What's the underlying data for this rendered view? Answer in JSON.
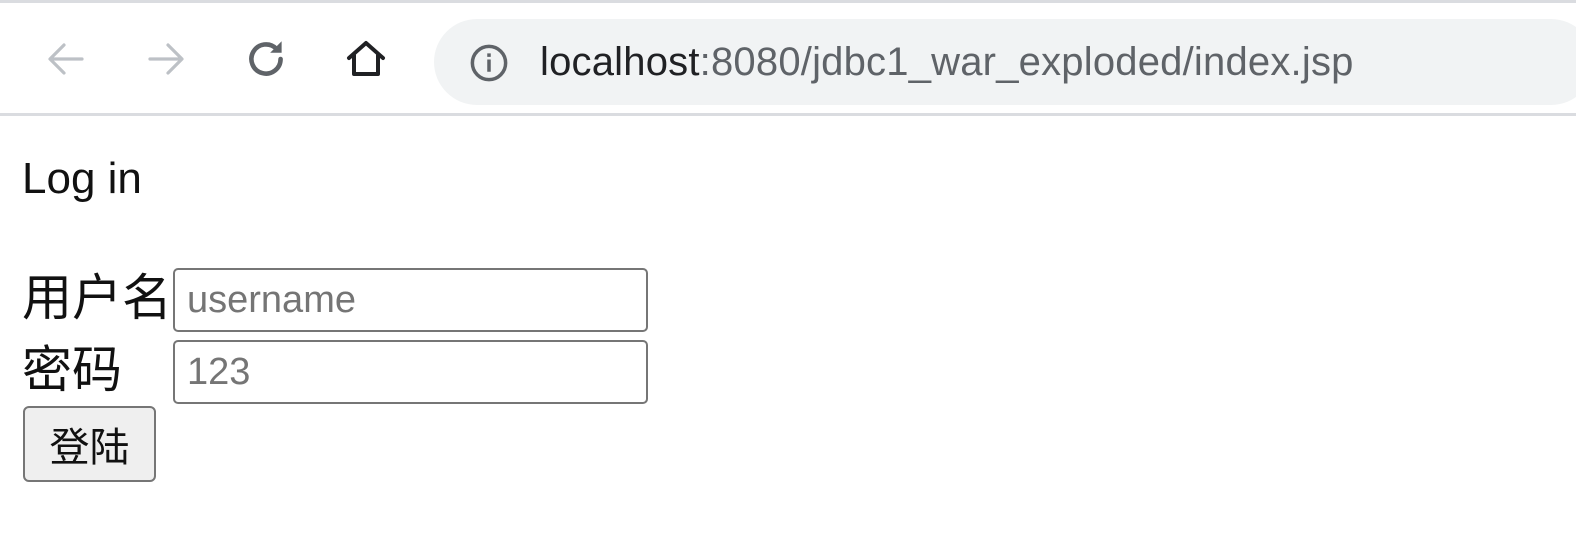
{
  "browser": {
    "url_host": "localhost",
    "url_rest": ":8080/jdbc1_war_exploded/index.jsp",
    "icons": [
      "back-arrow-icon",
      "forward-arrow-icon",
      "reload-icon",
      "home-icon",
      "site-info-icon"
    ]
  },
  "page": {
    "title": "Log in",
    "username_label": "用户名",
    "username_placeholder": "username",
    "password_label": "密码",
    "password_placeholder": "123",
    "submit_label": "登陆"
  }
}
